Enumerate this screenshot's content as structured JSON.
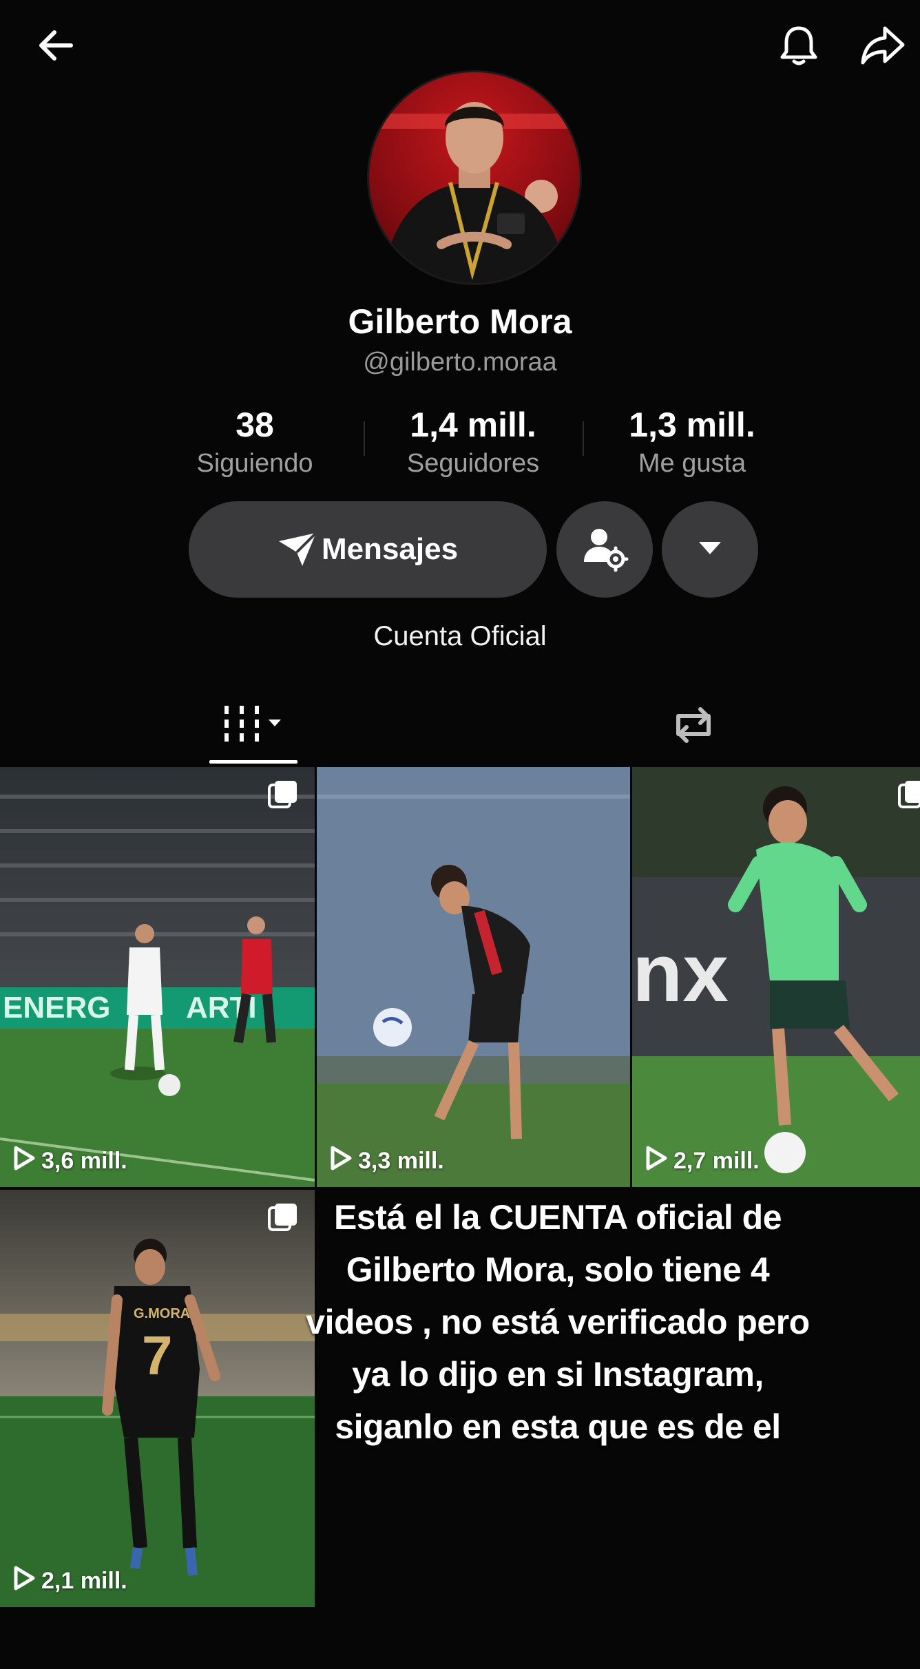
{
  "header": {
    "back_icon": "arrow-left-icon",
    "bell_icon": "bell-icon",
    "share_icon": "share-arrow-icon"
  },
  "profile": {
    "name": "Gilberto Mora",
    "handle": "@gilberto.moraa",
    "bio": "Cuenta Oficial"
  },
  "stats": [
    {
      "value": "38",
      "label": "Siguiendo"
    },
    {
      "value": "1,4 mill.",
      "label": "Seguidores"
    },
    {
      "value": "1,3 mill.",
      "label": "Me gusta"
    }
  ],
  "actions": {
    "message_label": "Mensajes"
  },
  "tabs": {
    "videos_icon": "grid-bars-icon",
    "reposts_icon": "repost-icon"
  },
  "videos": [
    {
      "views": "3,6 mill."
    },
    {
      "views": "3,3 mill."
    },
    {
      "views": "2,7 mill."
    },
    {
      "views": "2,1 mill."
    }
  ],
  "overlay_text": [
    "Está el la CUENTA oficial de",
    "Gilberto Mora, solo tiene 4",
    "videos , no está verificado pero",
    "ya lo dijo en si Instagram,",
    "siganlo en esta que es de el"
  ],
  "colors": {
    "background": "#060607",
    "button": "#3a3a3c",
    "muted_text": "#9a9a9a"
  }
}
